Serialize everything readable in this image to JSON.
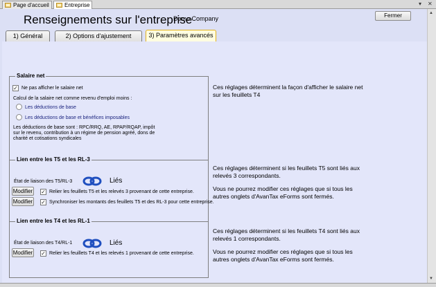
{
  "doc_tabs": [
    {
      "label": "Page d'accueil",
      "active": false
    },
    {
      "label": "Entreprise",
      "active": true
    }
  ],
  "window": {
    "dropdown_glyph": "▾",
    "close_glyph": "✕"
  },
  "header": {
    "title": "Renseignements sur l'entreprise",
    "company": "Demo Company",
    "close_label": "Fermer"
  },
  "tabs": [
    {
      "label": "1) Général",
      "active": false
    },
    {
      "label": "2) Options d'ajustement",
      "active": false
    },
    {
      "label": "3) Paramètres avancés",
      "active": true
    }
  ],
  "salaire": {
    "title": "Salaire net",
    "hide_label": "Ne pas afficher le salaire net",
    "hide_checked": true,
    "calc_label": "Calcul de la salaire net comme revenu d'emploi moins :",
    "radio1": "Les déductions de base",
    "radio2": "Les déductions de base et bénéfices imposables",
    "note_line1": "Les déductions de base sont : RPC/RRQ, AE, RPAP/RQAP, impôt",
    "note_line2": "sur le revenu, contribution à un régime de pension agréé, dons de",
    "note_line3": "charité et cotisations syndicales",
    "desc_line1": "Ces réglages déterminent la façon d'afficher le salaire net",
    "desc_line2": "sur les feuillets T4"
  },
  "t5": {
    "title": "Lien entre les T5 et les RL-3",
    "etat_label": "État de liaison des T5/RL-3",
    "status": "Liés",
    "modify_label": "Modifier",
    "check1": "Relier les feuillets T5 et les relevés 3 provenant de cette entreprise.",
    "check2": "Synchroniser les montants des feuillets T5 et des RL-3 pour cette entreprise.",
    "check1_checked": true,
    "check2_checked": true,
    "desc_line1": "Ces réglages déterminent si les feuillets T5 sont liés aux",
    "desc_line2": "relevés 3 correspondants.",
    "desc_line3": "Vous ne pourrez modifier ces réglages que si tous les",
    "desc_line4": "autres onglets d'AvanTax eForms sont fermés."
  },
  "t4": {
    "title": "Lien entre les T4 et les RL-1",
    "etat_label": "État de liaison des T4/RL-1",
    "status": "Liés",
    "modify_label": "Modifier",
    "check1": "Relier les feuillets T4 et les relevés 1 provenant de cette entreprise.",
    "check1_checked": true,
    "desc_line1": "Ces réglages déterminent si les feuillets T4 sont liés aux",
    "desc_line2": "relevés 1 correspondants.",
    "desc_line3": "Vous ne pourrez modifier ces réglages que si tous les",
    "desc_line4": "autres onglets d'AvanTax eForms sont fermés."
  },
  "colors": {
    "panel_bg": "#e3e6fa",
    "active_tab_border": "#e2b11c",
    "link_icon": "#1f4fbf"
  },
  "icons": {
    "tab_icon": "folder-icon",
    "link": "chain-link-icon"
  }
}
